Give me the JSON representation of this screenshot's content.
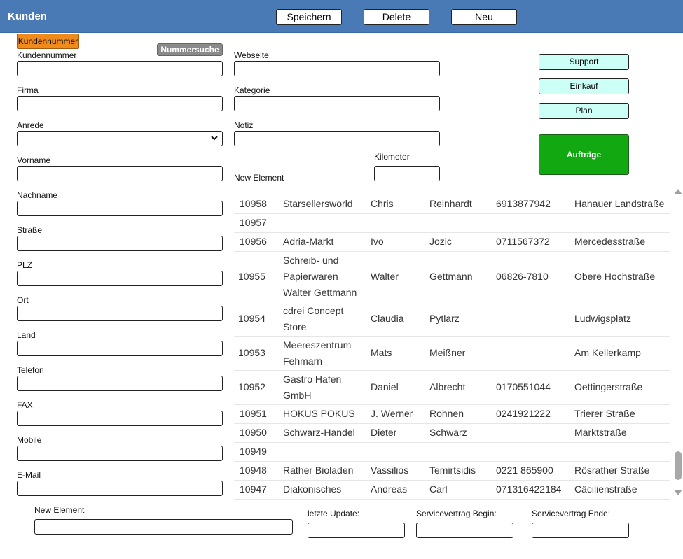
{
  "header": {
    "title": "Kunden",
    "save_label": "Speichern",
    "delete_label": "Delete",
    "new_label": "Neu"
  },
  "left": {
    "kundennummer_button": "Kundennummer",
    "nummersuche_button": "Nummersuche",
    "fields": {
      "kundennummer": "Kundennummer",
      "firma": "Firma",
      "anrede": "Anrede",
      "vorname": "Vorname",
      "nachname": "Nachname",
      "strasse": "Straße",
      "plz": "PLZ",
      "ort": "Ort",
      "land": "Land",
      "telefon": "Telefon",
      "fax": "FAX",
      "mobile": "Mobile",
      "email": "E-Mail"
    }
  },
  "middle": {
    "webseite": "Webseite",
    "kategorie": "Kategorie",
    "notiz": "Notiz",
    "kilometer": "Kilometer",
    "new_element": "New Element"
  },
  "side_buttons": {
    "support": "Support",
    "einkauf": "Einkauf",
    "plan": "Plan",
    "auftraege": "Aufträge"
  },
  "table": {
    "rows": [
      {
        "id": "10958",
        "firma": "Starsellersworld",
        "vorname": "Chris",
        "nachname": "Reinhardt",
        "telefon": "6913877942",
        "strasse": "Hanauer Landstraße"
      },
      {
        "id": "10957",
        "firma": "",
        "vorname": "",
        "nachname": "",
        "telefon": "",
        "strasse": ""
      },
      {
        "id": "10956",
        "firma": "Adria-Markt",
        "vorname": "Ivo",
        "nachname": "Jozic",
        "telefon": "0711567372",
        "strasse": "Mercedesstraße"
      },
      {
        "id": "10955",
        "firma": "Schreib- und Papierwaren Walter Gettmann",
        "vorname": "Walter",
        "nachname": "Gettmann",
        "telefon": "06826-7810",
        "strasse": "Obere Hochstraße"
      },
      {
        "id": "10954",
        "firma": "cdrei Concept Store",
        "vorname": "Claudia",
        "nachname": "Pytlarz",
        "telefon": "",
        "strasse": "Ludwigsplatz"
      },
      {
        "id": "10953",
        "firma": "Meereszentrum Fehmarn",
        "vorname": "Mats",
        "nachname": "Meißner",
        "telefon": "",
        "strasse": "Am Kellerkamp"
      },
      {
        "id": "10952",
        "firma": "Gastro Hafen GmbH",
        "vorname": "Daniel",
        "nachname": "Albrecht",
        "telefon": "0170551044",
        "strasse": "Oettingerstraße"
      },
      {
        "id": "10951",
        "firma": "HOKUS POKUS",
        "vorname": "J. Werner",
        "nachname": "Rohnen",
        "telefon": "0241921222",
        "strasse": "Trierer Straße"
      },
      {
        "id": "10950",
        "firma": "Schwarz-Handel",
        "vorname": "Dieter",
        "nachname": "Schwarz",
        "telefon": "",
        "strasse": "Marktstraße"
      },
      {
        "id": "10949",
        "firma": "",
        "vorname": "",
        "nachname": "",
        "telefon": "",
        "strasse": ""
      },
      {
        "id": "10948",
        "firma": "Rather Bioladen",
        "vorname": "Vassilios",
        "nachname": "Temirtsidis",
        "telefon": "0221 865900",
        "strasse": "Rösrather Straße"
      },
      {
        "id": "10947",
        "firma": "Diakonisches",
        "vorname": "Andreas",
        "nachname": "Carl",
        "telefon": "071316422184",
        "strasse": "Cäcilienstraße"
      }
    ]
  },
  "footer": {
    "new_element": "New Element",
    "letzte_update": "letzte Update:",
    "service_begin": "Servicevertrag Begin:",
    "service_ende": "Servicevertrag Ende:"
  }
}
